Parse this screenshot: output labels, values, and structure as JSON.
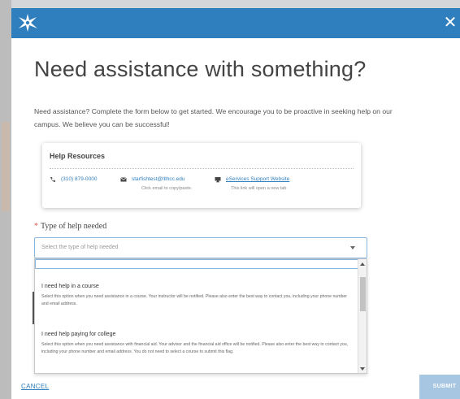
{
  "header": {
    "logo_icon": "starburst-logo-icon",
    "close_symbol": "✕"
  },
  "title": "Need assistance with something?",
  "intro": "Need assistance? Complete the form below to get started. We encourage you to be proactive in seeking help on our campus. We believe you can be successful!",
  "resources": {
    "title": "Help Resources",
    "phone": "(310) 879-0000",
    "email": "starfishtest@ltlhcc.edu",
    "email_note": "Click email to copy/paste.",
    "website": "eServices Support Website",
    "website_note": "This link will open a new tab"
  },
  "field": {
    "required_mark": "*",
    "label": "Type of help needed",
    "placeholder": "Select the type of help needed"
  },
  "options": [
    {
      "title": "I need help in a course",
      "description": "Select this option when you need assistance in a course. Your instructor will be notified. Please also enter the best way to contact you, including your phone number and email address."
    },
    {
      "title": "I need help paying for college",
      "description": "Select this option when you need assistance with financial aid. Your advisor and the financial aid office will be notified. Please also enter the best way to contact you, including your phone number and email address. You do not need to select a course to submit this flag."
    }
  ],
  "footer": {
    "cancel": "CANCEL",
    "submit": "SUBMIT"
  },
  "colors": {
    "header": "#2f7ebd",
    "link": "#2f7ebd",
    "submit_disabled": "#a6c6e2",
    "required": "#e05a5a"
  }
}
